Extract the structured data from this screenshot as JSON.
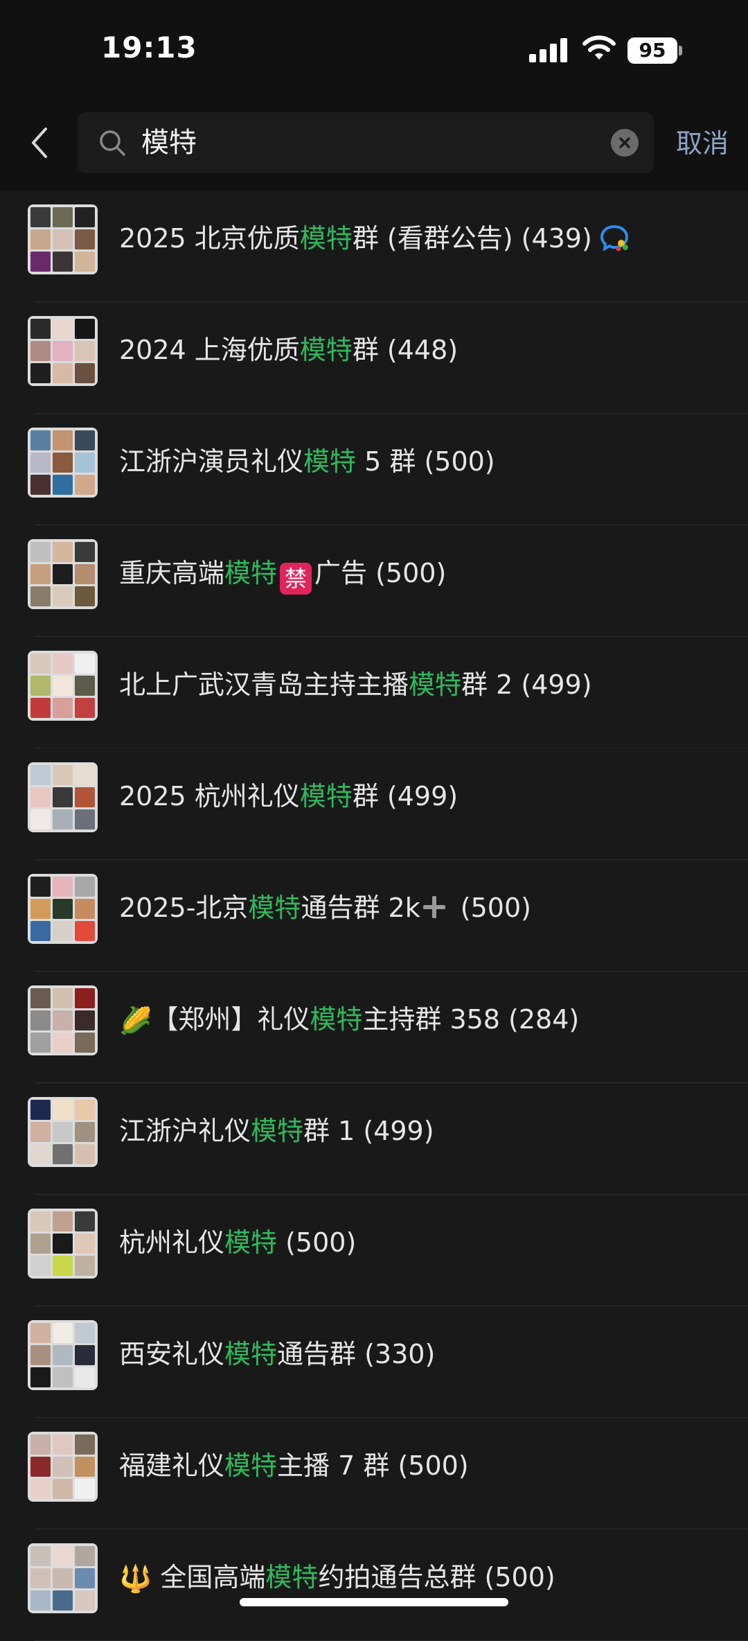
{
  "status_bar": {
    "time": "19:13",
    "battery": "95"
  },
  "search": {
    "query": "模特",
    "cancel_label": "取消"
  },
  "highlight_color": "#2fb95e",
  "results": [
    {
      "before": "2025 北京优质",
      "match": "模特",
      "after": "群 (看群公告) (439)",
      "suffix_icon": "chat-bubble-icon",
      "avatar_colors": [
        "#3a3a3a",
        "#6b6b55",
        "#222",
        "#c7a88e",
        "#d4c3b5",
        "#7a5b48",
        "#6a2a6a",
        "#3b3535",
        "#d1b49a"
      ]
    },
    {
      "before": "2024 上海优质",
      "match": "模特",
      "after": "群 (448)",
      "avatar_colors": [
        "#2a2a2a",
        "#e9d6cf",
        "#151515",
        "#b08a84",
        "#e0b2c2",
        "#d9c4b6",
        "#1f1f1f",
        "#d8b8a6",
        "#6b5040"
      ]
    },
    {
      "before": "江浙沪演员礼仪",
      "match": "模特",
      "after": " 5 群 (500)",
      "avatar_colors": [
        "#5b7fa0",
        "#c49372",
        "#3a4a5a",
        "#b8b8c8",
        "#8a5b3e",
        "#a6c2d8",
        "#4a3030",
        "#2f6fa0",
        "#d1a98a"
      ]
    },
    {
      "before": "重庆高端",
      "match": "模特",
      "ban_badge": "禁",
      "after": "广告 (500)",
      "avatar_colors": [
        "#bfbfbf",
        "#d3b69c",
        "#3a3a3a",
        "#c59f7e",
        "#1e1e1e",
        "#b48c6e",
        "#8a7d6a",
        "#d9cbbb",
        "#6b5a3e"
      ]
    },
    {
      "before": "北上广武汉青岛主持主播",
      "match": "模特",
      "after": "群 2 (499)",
      "avatar_colors": [
        "#d8c8bb",
        "#e5c9c4",
        "#f0f0f0",
        "#b0b86a",
        "#f3e6dc",
        "#5b5b4a",
        "#c23a3a",
        "#d7a09a",
        "#c24040"
      ]
    },
    {
      "before": "2025 杭州礼仪",
      "match": "模特",
      "after": "群 (499)",
      "avatar_colors": [
        "#bfc9d4",
        "#d9c8b8",
        "#e6dcd0",
        "#e8c7c1",
        "#3a3a3a",
        "#b0553a",
        "#f0e8e8",
        "#a8aeb6",
        "#6b6f7a"
      ]
    },
    {
      "before": "2025-北京",
      "match": "模特",
      "after": "通告群 2k",
      "plus": true,
      "after2": " (500)",
      "avatar_colors": [
        "#1f1f1f",
        "#e5b5bb",
        "#a8a8a8",
        "#d39b5a",
        "#2a3a2a",
        "#c68a60",
        "#3a6aa0",
        "#d7d0c8",
        "#e24a3a"
      ]
    },
    {
      "before": "",
      "emoji": "🌽",
      "before2": "【郑州】礼仪",
      "match": "模特",
      "after": "主持群 358 (284)",
      "avatar_colors": [
        "#6a5a50",
        "#d0c0b0",
        "#8a2020",
        "#8a8a8a",
        "#c9b0a8",
        "#3a2a2a",
        "#a0a0a0",
        "#e8d0c8",
        "#7a6a5a"
      ]
    },
    {
      "before": "江浙沪礼仪",
      "match": "模特",
      "after": "群 1 (499)",
      "avatar_colors": [
        "#1d2a50",
        "#f0e0c8",
        "#e8c8a8",
        "#d0b0a0",
        "#c8c8c8",
        "#a09080",
        "#e0d8d0",
        "#707070",
        "#d8c0b0"
      ]
    },
    {
      "before": "杭州礼仪",
      "match": "模特",
      "after": " (500)",
      "avatar_colors": [
        "#d8c8b8",
        "#c0a090",
        "#3a3a3a",
        "#b0a090",
        "#1a1a1a",
        "#e0c8b8",
        "#d0d0d0",
        "#c8d84a",
        "#c0b0a0"
      ]
    },
    {
      "before": "西安礼仪",
      "match": "模特",
      "after": "通告群 (330)",
      "avatar_colors": [
        "#d0b0a0",
        "#f0ece4",
        "#c0c8d0",
        "#a89080",
        "#b0b8c0",
        "#2a2a3a",
        "#1a1a1a",
        "#c0c0c0",
        "#e8e8e8"
      ]
    },
    {
      "before": "福建礼仪",
      "match": "模特",
      "after": "主播 7 群 (500)",
      "avatar_colors": [
        "#c8b0a8",
        "#e0c8c0",
        "#7a6a5a",
        "#8a2a2a",
        "#d0c0b8",
        "#c09060",
        "#e8d0c8",
        "#d0b8a8",
        "#f0f0f0"
      ]
    },
    {
      "before": "",
      "emoji": "🔱",
      "before2": " 全国高端",
      "match": "模特",
      "after": "约拍通告总群 (500)",
      "avatar_colors": [
        "#c8c0b8",
        "#e8d8d0",
        "#b0a8a0",
        "#d0c0b8",
        "#c8b8b0",
        "#6a8ab0",
        "#a8b8c8",
        "#4a6a8a",
        "#d8c8c0"
      ]
    }
  ]
}
